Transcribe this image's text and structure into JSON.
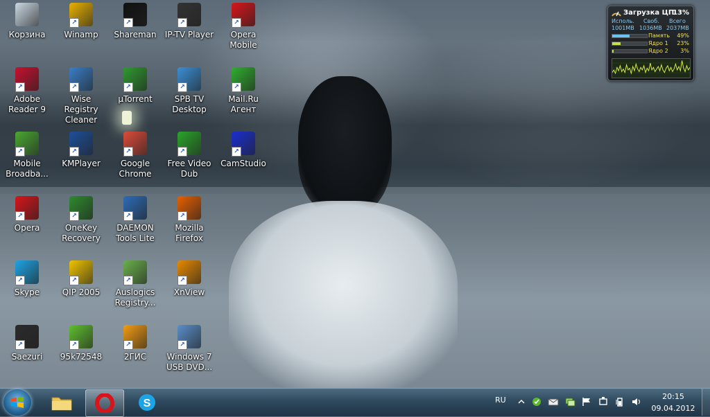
{
  "desktop": {
    "icons": [
      {
        "label": "Корзина",
        "icon": "recycle-bin-icon",
        "color": "#c9d7e3"
      },
      {
        "label": "Adobe Reader 9",
        "icon": "adobe-reader-icon",
        "color": "#c8102e"
      },
      {
        "label": "Mobile Broadba...",
        "icon": "mobile-broadband-icon",
        "color": "#4aa832"
      },
      {
        "label": "Opera",
        "icon": "opera-icon",
        "color": "#d7151a"
      },
      {
        "label": "Skype",
        "icon": "skype-icon",
        "color": "#1da4e5"
      },
      {
        "label": "Saezuri",
        "icon": "saezuri-icon",
        "color": "#2b2b2b"
      },
      {
        "label": "Winamp",
        "icon": "winamp-icon",
        "color": "#e8b200"
      },
      {
        "label": "Wise Registry Cleaner",
        "icon": "wise-registry-icon",
        "color": "#3a7ec7"
      },
      {
        "label": "KMPlayer",
        "icon": "kmplayer-icon",
        "color": "#1d4f9a"
      },
      {
        "label": "OneKey Recovery",
        "icon": "onekey-recovery-icon",
        "color": "#2e8a2e"
      },
      {
        "label": "QIP 2005",
        "icon": "qip-icon",
        "color": "#f0c400"
      },
      {
        "label": "95k72548",
        "icon": "shield-icon",
        "color": "#5fbf2f"
      },
      {
        "label": "Shareman",
        "icon": "shareman-icon",
        "color": "#111111"
      },
      {
        "label": "µTorrent",
        "icon": "utorrent-icon",
        "color": "#2f9a2f"
      },
      {
        "label": "Google Chrome",
        "icon": "chrome-icon",
        "color": "#dd4b39"
      },
      {
        "label": "DAEMON Tools Lite",
        "icon": "daemon-tools-icon",
        "color": "#2c6cb8"
      },
      {
        "label": "Auslogics Registry...",
        "icon": "auslogics-icon",
        "color": "#6ab04c"
      },
      {
        "label": "2ГИС",
        "icon": "2gis-icon",
        "color": "#f39c12"
      },
      {
        "label": "IP-TV Player",
        "icon": "iptv-icon",
        "color": "#333333"
      },
      {
        "label": "SPB TV Desktop",
        "icon": "spbtv-icon",
        "color": "#3b8fd6"
      },
      {
        "label": "Free Video Dub",
        "icon": "free-video-dub-icon",
        "color": "#2aa52a"
      },
      {
        "label": "Mozilla Firefox",
        "icon": "firefox-icon",
        "color": "#e66000"
      },
      {
        "label": "XnView",
        "icon": "xnview-icon",
        "color": "#e68a00"
      },
      {
        "label": "Windows 7 USB DVD...",
        "icon": "win7-usb-icon",
        "color": "#5a8ec9"
      },
      {
        "label": "Opera Mobile",
        "icon": "opera-mobile-icon",
        "color": "#d7151a"
      },
      {
        "label": "Mail.Ru Агент",
        "icon": "mailru-agent-icon",
        "color": "#2fae2f"
      },
      {
        "label": "CamStudio",
        "icon": "camstudio-icon",
        "color": "#1a2fd0"
      }
    ]
  },
  "gadget": {
    "title": "Загрузка ЦП",
    "cpu_percent": "13%",
    "headers": [
      "Исполь.",
      "Своб.",
      "Всего"
    ],
    "values": [
      "1001MB",
      "1036MB",
      "2037MB"
    ],
    "rows": [
      {
        "label": "Память",
        "value": "49%",
        "fill": 0.49
      },
      {
        "label": "Ядро 1",
        "value": "23%",
        "fill": 0.23
      },
      {
        "label": "Ядро 2",
        "value": "3%",
        "fill": 0.03
      }
    ],
    "graph": [
      6,
      9,
      5,
      12,
      8,
      14,
      7,
      10,
      6,
      15,
      9,
      11,
      5,
      13,
      8,
      16,
      10,
      7,
      12,
      9,
      14,
      6,
      11,
      8,
      17,
      9,
      12,
      7,
      10,
      13,
      8,
      15,
      9,
      6,
      11,
      14,
      8,
      12,
      7,
      10,
      16,
      9,
      13,
      8,
      20,
      11,
      7,
      14,
      9,
      12
    ]
  },
  "taskbar": {
    "start_label": "Start",
    "pinned": [
      {
        "name": "explorer",
        "icon": "folder-icon"
      },
      {
        "name": "opera",
        "icon": "opera-icon",
        "active": true
      },
      {
        "name": "skype",
        "icon": "skype-icon"
      }
    ],
    "language": "RU",
    "tray_icons": [
      "show-hidden-icon",
      "antivirus-icon",
      "mail-icon",
      "network-icon",
      "action-center-flag-icon",
      "usb-device-icon",
      "power-icon",
      "volume-icon"
    ],
    "time": "20:15",
    "date": "09.04.2012"
  }
}
